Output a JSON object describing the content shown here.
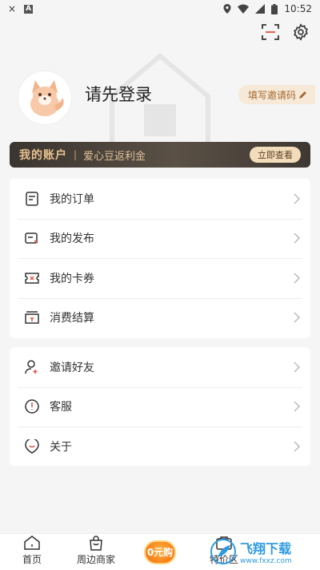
{
  "statusbar": {
    "time": "10:52",
    "notif_x": "×",
    "notif_a": "A"
  },
  "profile": {
    "login_prompt": "请先登录",
    "invite_code_label": "填写邀请码"
  },
  "account": {
    "title": "我的账户",
    "separator": "|",
    "subtitle": "爱心豆返利金",
    "view_button": "立即查看"
  },
  "menu_group1": [
    {
      "label": "我的订单",
      "icon": "order-icon"
    },
    {
      "label": "我的发布",
      "icon": "publish-icon"
    },
    {
      "label": "我的卡券",
      "icon": "coupon-icon"
    },
    {
      "label": "消费结算",
      "icon": "settlement-icon"
    }
  ],
  "menu_group2": [
    {
      "label": "邀请好友",
      "icon": "invite-friend-icon"
    },
    {
      "label": "客服",
      "icon": "customer-service-icon"
    },
    {
      "label": "关于",
      "icon": "about-icon"
    }
  ],
  "tabbar": {
    "home": "首页",
    "nearby": "周边商家",
    "zero": "0元购",
    "special": "特价区"
  },
  "watermark": {
    "brand": "飞翔下载",
    "url": "www.fxxz.com"
  },
  "colors": {
    "accent": "#e8c28f",
    "banner_dark": "#3a3530",
    "invite_text": "#a3682e"
  }
}
